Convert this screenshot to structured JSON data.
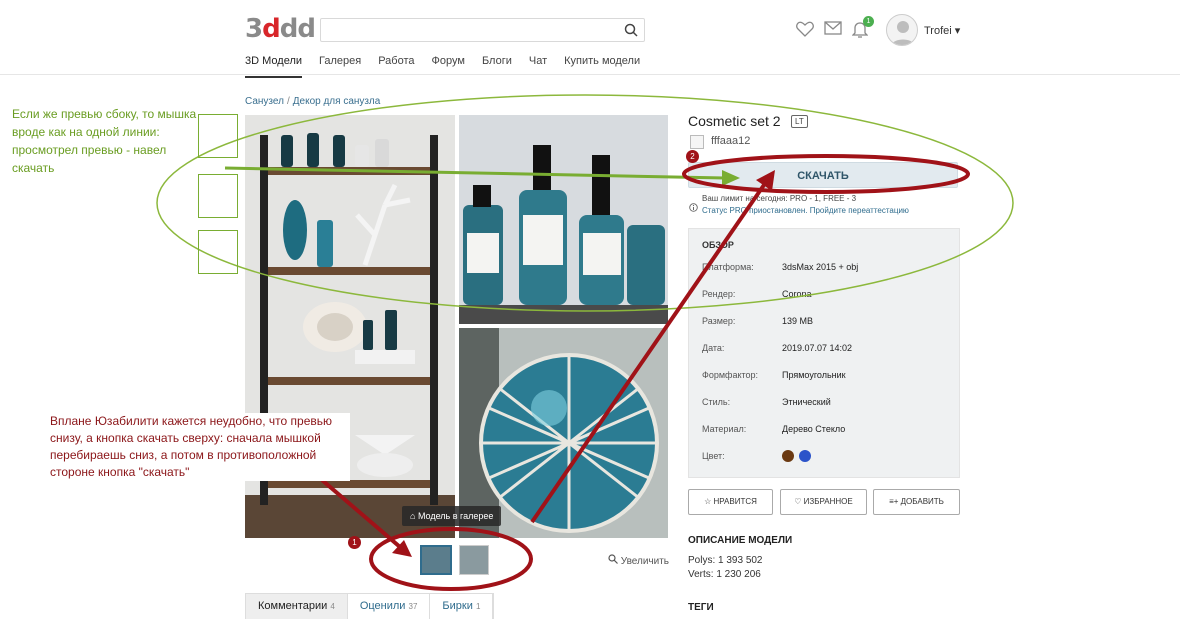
{
  "header": {
    "logo_prefix": "3",
    "logo_mid": "d",
    "logo_rest": "dd",
    "search_placeholder": "",
    "bell_count": "1",
    "username": "Trofei",
    "nav": [
      "3D Модели",
      "Галерея",
      "Работа",
      "Форум",
      "Блоги",
      "Чат",
      "Купить модели"
    ]
  },
  "breadcrumb": {
    "first": "Санузел",
    "separator": "/",
    "second": "Декор для санузла"
  },
  "gallery": {
    "in_gallery_label": "Модель в галерее",
    "zoom_label": "Увеличить"
  },
  "tabs": [
    {
      "label": "Комментарии",
      "count": "4"
    },
    {
      "label": "Оценили",
      "count": "37"
    },
    {
      "label": "Бирки",
      "count": "1"
    }
  ],
  "model": {
    "title": "Cosmetic set 2",
    "badge": "LT",
    "author": "fffaaa12",
    "download_label": "СКАЧАТЬ",
    "limit_text": "Ваш лимит на сегодня: PRO - 1, FREE - 3",
    "status_text": "Статус PRO приостановлен. Пройдите переаттестацию",
    "overview_label": "ОБЗОР",
    "specs": [
      {
        "label": "Платформа:",
        "value": "3dsMax 2015 + obj"
      },
      {
        "label": "Рендер:",
        "value": "Corona"
      },
      {
        "label": "Размер:",
        "value": "139 MB"
      },
      {
        "label": "Дата:",
        "value": "2019.07.07 14:02"
      },
      {
        "label": "Формфактор:",
        "value": "Прямоугольник"
      },
      {
        "label": "Стиль:",
        "value": "Этнический"
      },
      {
        "label": "Материал:",
        "value": "Дерево Стекло"
      },
      {
        "label": "Цвет:",
        "value": ""
      }
    ],
    "colors": [
      "#6b3a12",
      "#2b53c9"
    ],
    "actions": {
      "like": "НРАВИТСЯ",
      "favorite": "ИЗБРАННОЕ",
      "add": "ДОБАВИТЬ"
    },
    "description_heading": "ОПИСАНИЕ МОДЕЛИ",
    "polys": "Polys: 1 393 502",
    "verts": "Verts: 1 230 206",
    "tags_heading": "ТЕГИ"
  },
  "annotations": {
    "green_note": "Если же превью сбоку, то мышка вроде как на одной линии: просмотрел превью - навел скачать",
    "red_note": "Вплане Юзабилити кажется неудобно, что превью снизу, а кнопка скачать сверху: сначала мышкой перебираешь сниз, а потом в противоположной стороне кнопка \"скачать\"",
    "marker_1": "1",
    "marker_2": "2"
  },
  "colors": {
    "accent": "#2f6c8d",
    "annotation_red": "#a01218",
    "annotation_green": "#79ad32"
  }
}
